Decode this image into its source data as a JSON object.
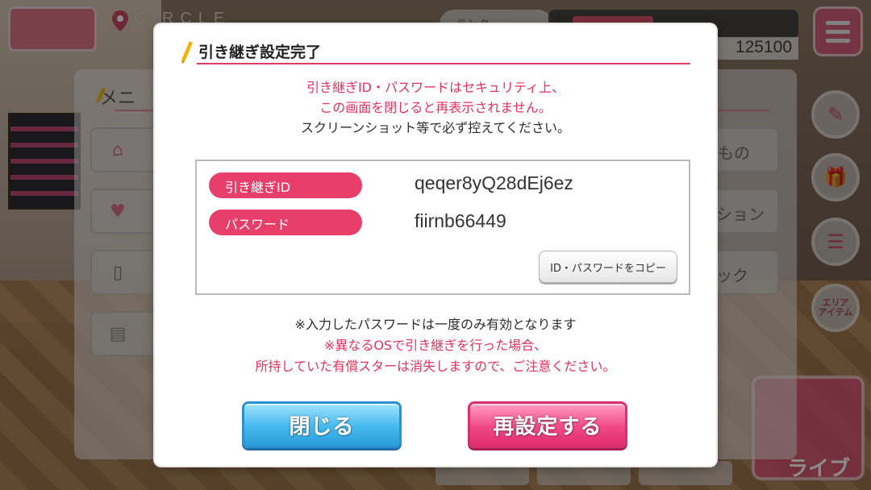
{
  "background": {
    "location_label": "CiRCLE",
    "rank_label": "ランク",
    "money": "125100",
    "side_buttons": [
      "pen-icon",
      "gift-icon",
      "list-icon"
    ],
    "area_item_label": "エリア\nアイテム",
    "live_label": "ライブ",
    "menu": {
      "title": "メニ",
      "right_labels": [
        "もの",
        "ション",
        "ック"
      ]
    }
  },
  "dialog": {
    "title": "引き継ぎ設定完了",
    "warning_line1": "引き継ぎID・パスワードはセキュリティ上、",
    "warning_line2": "この画面を閉じると再表示されません。",
    "warning_line3": "スクリーンショット等で必ず控えてください。",
    "id_label": "引き継ぎID",
    "id_value": "qeqer8yQ28dEj6ez",
    "password_label": "パスワード",
    "password_value": "fiirnb66449",
    "copy_button": "ID・パスワードをコピー",
    "note1": "※入力したパスワードは一度のみ有効となります",
    "note2": "※異なるOSで引き継ぎを行った場合、",
    "note3": "所持していた有償スターは消失しますので、ご注意ください。",
    "close_button": "閉じる",
    "reset_button": "再設定する"
  },
  "colors": {
    "accent_pink": "#e83f6a",
    "warning_red": "#e6325c",
    "close_blue": "#47b9ee",
    "reset_pink": "#f04a83"
  }
}
